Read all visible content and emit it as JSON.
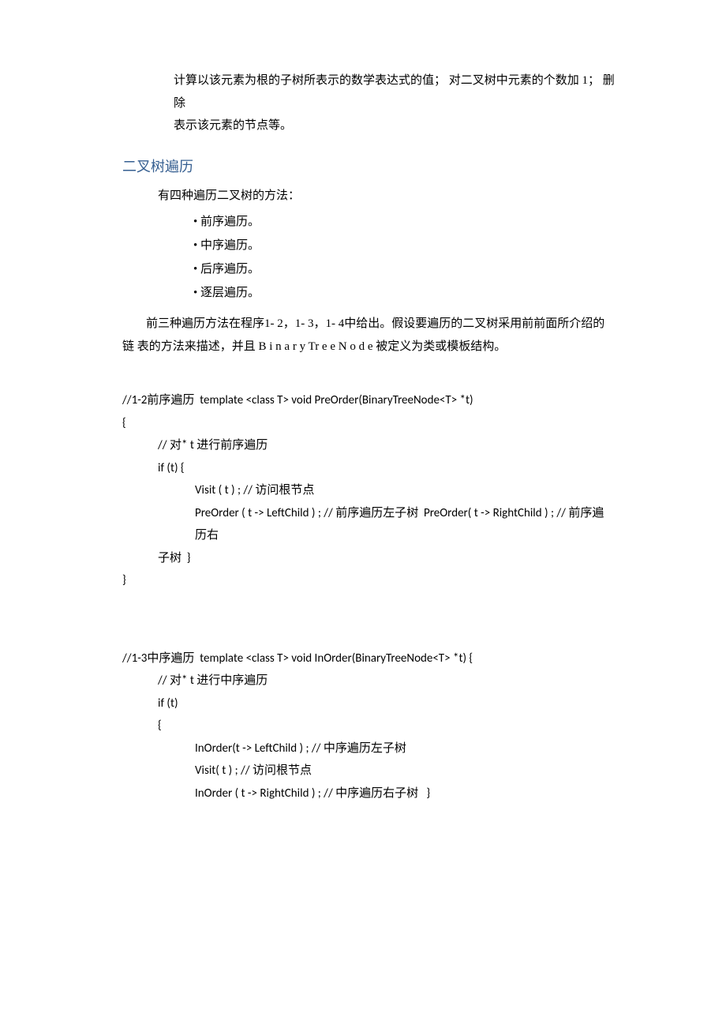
{
  "intro": {
    "line1": "计算以该元素为根的子树所表示的数学表达式的值；  对二叉树中元素的个数加  1；  删除",
    "line2": "表示该元素的节点等。"
  },
  "heading": "二叉树遍历",
  "method_intro": "有四种遍历二叉树的方法：",
  "methods": [
    "• 前序遍历。",
    "• 中序遍历。",
    "• 后序遍历。",
    "• 逐层遍历。"
  ],
  "para1": "前三种遍历方法在程序1- 2，1- 3，1- 4中给出。假设要遍历的二叉树采用前前面所介绍的链  表的方法来描述，并且  B i n a r y Tr e e N o d e 被定义为类或模板结构。",
  "code1": {
    "l1": "//1-2前序遍历  template <class T> void PreOrder(BinaryTreeNode<T> *t)",
    "l2": "{",
    "l3": "// 对* t 进行前序遍历",
    "l4": "if (t) {",
    "l5": "Visit ( t ) ; // 访问根节点",
    "l6": "PreOrder ( t -> LeftChild ) ; // 前序遍历左子树  PreOrder( t -> RightChild ) ; // 前序遍历右",
    "l6b": "子树  }",
    "l7": "}"
  },
  "code2": {
    "l1": "//1-3中序遍历  template <class T> void InOrder(BinaryTreeNode<T> *t) {",
    "l2": "// 对* t 进行中序遍历",
    "l3": "if (t)",
    "l4": "{",
    "l5": "InOrder(t -> LeftChild ) ; // 中序遍历左子树",
    "l6": "Visit( t ) ; // 访问根节点",
    "l7": "InOrder ( t -> RightChild ) ; // 中序遍历右子树   }"
  }
}
